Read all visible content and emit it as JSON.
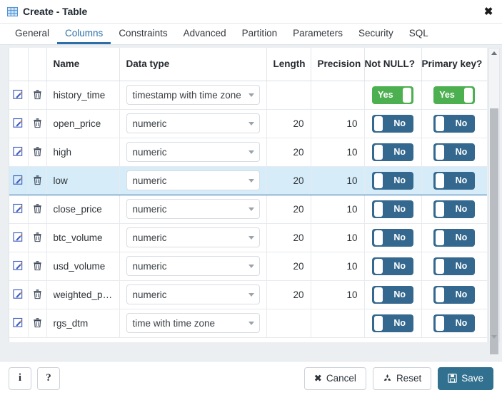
{
  "window": {
    "title": "Create - Table",
    "title_icon": "table-grid-icon",
    "close_icon": "close-icon"
  },
  "tabs": [
    {
      "label": "General",
      "active": false
    },
    {
      "label": "Columns",
      "active": true
    },
    {
      "label": "Constraints",
      "active": false
    },
    {
      "label": "Advanced",
      "active": false
    },
    {
      "label": "Partition",
      "active": false
    },
    {
      "label": "Parameters",
      "active": false
    },
    {
      "label": "Security",
      "active": false
    },
    {
      "label": "SQL",
      "active": false
    }
  ],
  "grid": {
    "headers": [
      "",
      "",
      "Name",
      "Data type",
      "Length",
      "Precision",
      "Not NULL?",
      "Primary key?"
    ],
    "edit_icon": "edit-pencil-icon",
    "delete_icon": "trash-icon",
    "rows": [
      {
        "name": "history_time",
        "data_type": "timestamp with time zone",
        "length": "",
        "precision": "",
        "not_null": "Yes",
        "primary_key": "Yes",
        "selected": false,
        "length_disabled": false,
        "precision_disabled": true
      },
      {
        "name": "open_price",
        "data_type": "numeric",
        "length": "20",
        "precision": "10",
        "not_null": "No",
        "primary_key": "No",
        "selected": false,
        "length_disabled": false,
        "precision_disabled": false
      },
      {
        "name": "high",
        "data_type": "numeric",
        "length": "20",
        "precision": "10",
        "not_null": "No",
        "primary_key": "No",
        "selected": false,
        "length_disabled": false,
        "precision_disabled": false
      },
      {
        "name": "low",
        "data_type": "numeric",
        "length": "20",
        "precision": "10",
        "not_null": "No",
        "primary_key": "No",
        "selected": true,
        "length_disabled": false,
        "precision_disabled": false
      },
      {
        "name": "close_price",
        "data_type": "numeric",
        "length": "20",
        "precision": "10",
        "not_null": "No",
        "primary_key": "No",
        "selected": false,
        "length_disabled": false,
        "precision_disabled": false
      },
      {
        "name": "btc_volume",
        "data_type": "numeric",
        "length": "20",
        "precision": "10",
        "not_null": "No",
        "primary_key": "No",
        "selected": false,
        "length_disabled": false,
        "precision_disabled": false
      },
      {
        "name": "usd_volume",
        "data_type": "numeric",
        "length": "20",
        "precision": "10",
        "not_null": "No",
        "primary_key": "No",
        "selected": false,
        "length_disabled": false,
        "precision_disabled": false
      },
      {
        "name": "weighted_price",
        "data_type": "numeric",
        "length": "20",
        "precision": "10",
        "not_null": "No",
        "primary_key": "No",
        "selected": false,
        "length_disabled": false,
        "precision_disabled": false
      },
      {
        "name": "rgs_dtm",
        "data_type": "time with time zone",
        "length": "",
        "precision": "",
        "not_null": "No",
        "primary_key": "No",
        "selected": false,
        "length_disabled": false,
        "precision_disabled": true
      }
    ]
  },
  "footer": {
    "info_label": "i",
    "help_label": "?",
    "cancel_label": "Cancel",
    "reset_label": "Reset",
    "save_label": "Save",
    "cancel_icon": "x-icon",
    "reset_icon": "recycle-icon",
    "save_icon": "floppy-disk-icon"
  },
  "colors": {
    "accent": "#2c6fa8",
    "toggle_yes": "#4caf50",
    "toggle_no": "#34688f",
    "save_button": "#31708f",
    "row_selected": "#d6ecf9",
    "disabled_cell": "#f0f2f5"
  },
  "scrollbar": {
    "up_icon": "arrow-up-icon",
    "down_icon": "arrow-down-icon"
  }
}
